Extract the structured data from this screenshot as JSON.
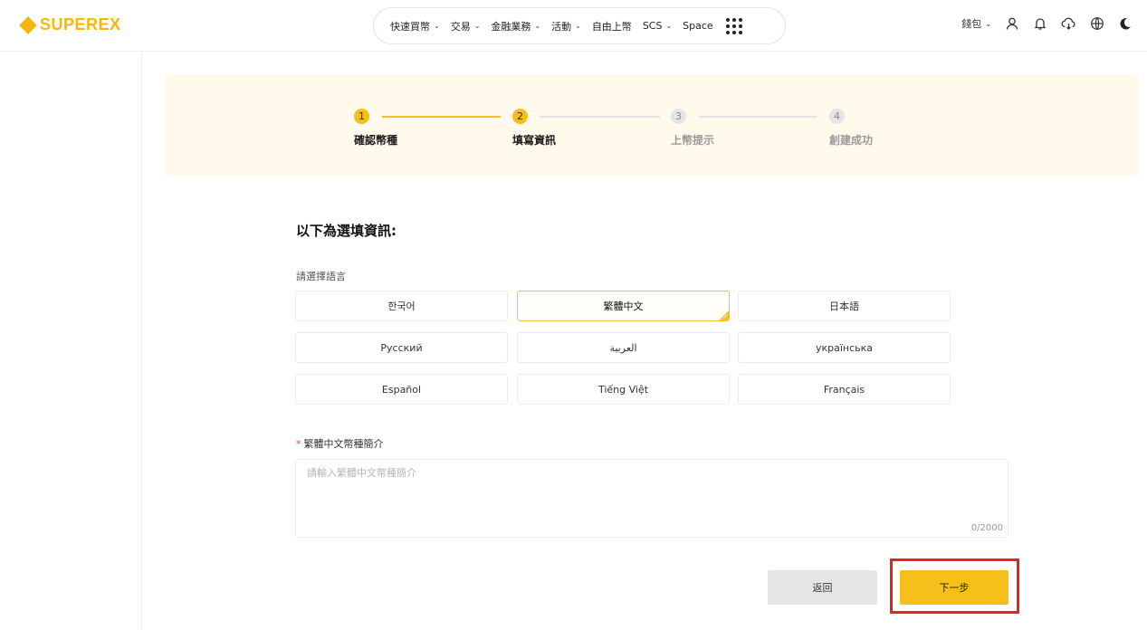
{
  "header": {
    "logo_text": "SUPEREX",
    "nav": [
      {
        "label": "快速買幣",
        "has_dropdown": true
      },
      {
        "label": "交易",
        "has_dropdown": true
      },
      {
        "label": "金融業務",
        "has_dropdown": true
      },
      {
        "label": "活動",
        "has_dropdown": true
      },
      {
        "label": "自由上幣",
        "has_dropdown": false
      },
      {
        "label": "SCS",
        "has_dropdown": true
      },
      {
        "label": "Space",
        "has_dropdown": false
      }
    ],
    "apps_icon": "grid-dots-icon",
    "wallet_label": "錢包",
    "icons": [
      "user-icon",
      "bell-icon",
      "download-cloud-icon",
      "globe-icon",
      "moon-icon"
    ]
  },
  "steps": [
    {
      "number": "1",
      "label": "確認幣種",
      "state": "active"
    },
    {
      "number": "2",
      "label": "填寫資訊",
      "state": "active"
    },
    {
      "number": "3",
      "label": "上幣提示",
      "state": "inactive"
    },
    {
      "number": "4",
      "label": "創建成功",
      "state": "inactive"
    }
  ],
  "form": {
    "section_title": "以下為選填資訊:",
    "language_label": "請選擇語言",
    "languages": [
      "한국어",
      "繁體中文",
      "日本語",
      "Русский",
      "العربية",
      "українська",
      "Español",
      "Tiếng Việt",
      "Français"
    ],
    "selected_language": "繁體中文",
    "description_required_mark": "*",
    "description_label": "繁體中文幣種簡介",
    "description_placeholder": "請輸入繁體中文幣種簡介",
    "description_value": "",
    "char_counter": "0/2000"
  },
  "buttons": {
    "back_label": "返回",
    "next_label": "下一步"
  },
  "colors": {
    "brand": "#f5b70d",
    "accent": "#f7bf1a",
    "highlight_box": "#e8231b",
    "steps_background": "#fffaec"
  }
}
